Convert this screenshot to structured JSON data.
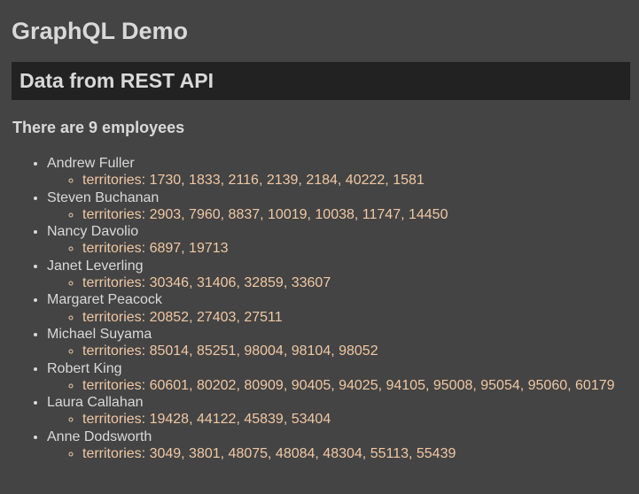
{
  "header": {
    "title": "GraphQL Demo"
  },
  "section": {
    "title": "Data from REST API"
  },
  "summary": {
    "count_text": "There are 9 employees"
  },
  "employees": [
    {
      "name": "Andrew Fuller",
      "territories": "territories: 1730, 1833, 2116, 2139, 2184, 40222, 1581"
    },
    {
      "name": "Steven Buchanan",
      "territories": "territories: 2903, 7960, 8837, 10019, 10038, 11747, 14450"
    },
    {
      "name": "Nancy Davolio",
      "territories": "territories: 6897, 19713"
    },
    {
      "name": "Janet Leverling",
      "territories": "territories: 30346, 31406, 32859, 33607"
    },
    {
      "name": "Margaret Peacock",
      "territories": "territories: 20852, 27403, 27511"
    },
    {
      "name": "Michael Suyama",
      "territories": "territories: 85014, 85251, 98004, 98104, 98052"
    },
    {
      "name": "Robert King",
      "territories": "territories: 60601, 80202, 80909, 90405, 94025, 94105, 95008, 95054, 95060, 60179"
    },
    {
      "name": "Laura Callahan",
      "territories": "territories: 19428, 44122, 45839, 53404"
    },
    {
      "name": "Anne Dodsworth",
      "territories": "territories: 3049, 3801, 48075, 48084, 48304, 55113, 55439"
    }
  ],
  "colors": {
    "background": "#444444",
    "banner_background": "#222222",
    "text": "#d9d9d9",
    "territory_text": "#f0c8a4"
  }
}
